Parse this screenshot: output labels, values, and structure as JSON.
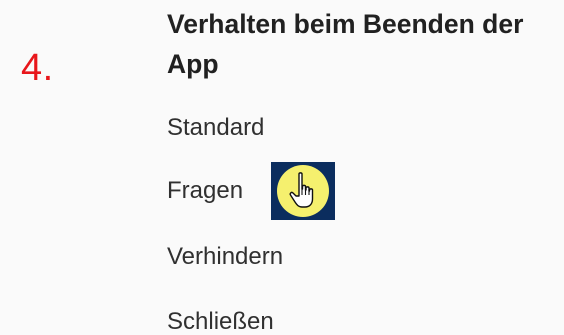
{
  "step": {
    "number": "4."
  },
  "section": {
    "title": "Verhalten beim Beenden der App"
  },
  "options": [
    {
      "label": "Standard"
    },
    {
      "label": "Fragen"
    },
    {
      "label": "Verhindern"
    },
    {
      "label": "Schließen"
    }
  ],
  "pointer": {
    "icon": "hand-pointer-icon",
    "highlight_color": "#f5f06e",
    "badge_color": "#0b2d5e"
  }
}
